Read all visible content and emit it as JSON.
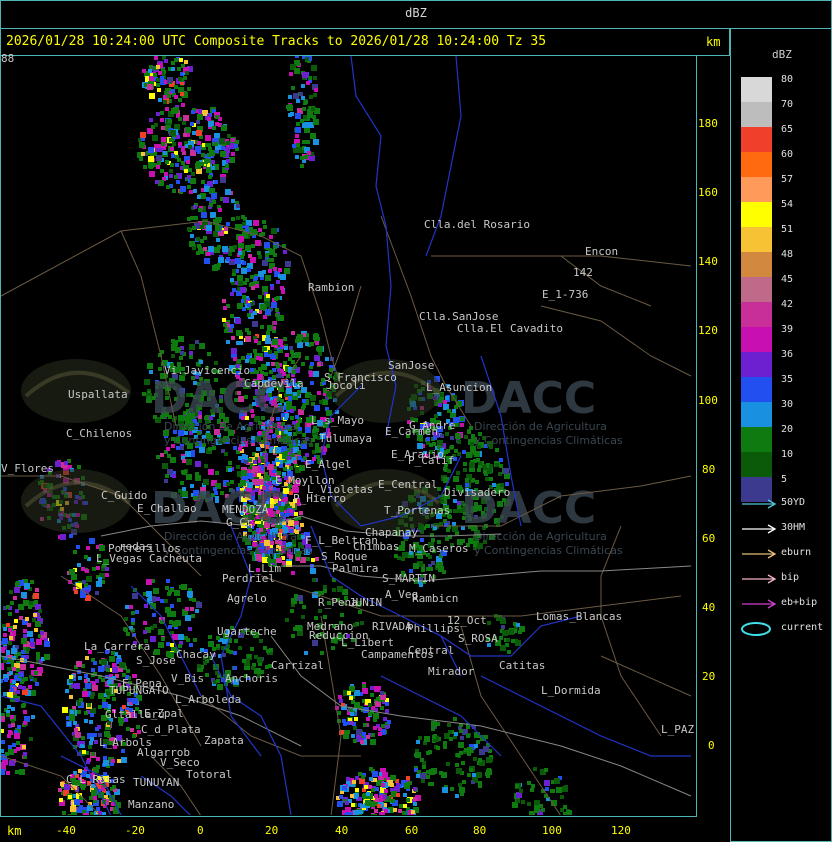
{
  "app": {
    "title": "dBZ"
  },
  "header": {
    "text": "2026/01/28 10:24:00 UTC Composite Tracks to 2026/01/28 10:24:00 Tz 35",
    "units": "km"
  },
  "axes": {
    "x_label": "km",
    "x_ticks": [
      "-40",
      "-20",
      "0",
      "20",
      "40",
      "60",
      "80",
      "100",
      "120"
    ],
    "y_ticks": [
      "180",
      "160",
      "140",
      "120",
      "100",
      "80",
      "60",
      "40",
      "20",
      "0"
    ]
  },
  "legend": {
    "title": "dBZ",
    "items": [
      {
        "label": "80",
        "color": "#d8d8d8"
      },
      {
        "label": "70",
        "color": "#bdbdbd"
      },
      {
        "label": "65",
        "color": "#f0402a"
      },
      {
        "label": "60",
        "color": "#ff6a10"
      },
      {
        "label": "57",
        "color": "#ff9a5a"
      },
      {
        "label": "54",
        "color": "#ffff00"
      },
      {
        "label": "51",
        "color": "#f7c234"
      },
      {
        "label": "48",
        "color": "#d2893f"
      },
      {
        "label": "45",
        "color": "#c06a8a"
      },
      {
        "label": "42",
        "color": "#c82f98"
      },
      {
        "label": "39",
        "color": "#c80fb0"
      },
      {
        "label": "36",
        "color": "#6d20d0"
      },
      {
        "label": "35",
        "color": "#2250f0"
      },
      {
        "label": "30",
        "color": "#1a90e0"
      },
      {
        "label": "20",
        "color": "#0e7a10"
      },
      {
        "label": "10",
        "color": "#0a5a0a"
      },
      {
        "label": "5",
        "color": "#3b3a8e"
      }
    ]
  },
  "tracks": [
    {
      "label": "50YD",
      "color": "#4fc8e0"
    },
    {
      "label": "30HM",
      "color": "#ffffff"
    },
    {
      "label": "eburn",
      "color": "#e8c07a"
    },
    {
      "label": "bip",
      "color": "#f4b4c4"
    },
    {
      "label": "eb+bip",
      "color": "#d040d0"
    },
    {
      "label": "current",
      "color": "#40e0e8"
    }
  ],
  "places": [
    {
      "name": "Clla.del Rosario"
    },
    {
      "name": "Encon"
    },
    {
      "name": "142"
    },
    {
      "name": "E_1-736"
    },
    {
      "name": "Rambion"
    },
    {
      "name": "Clla.SanJose"
    },
    {
      "name": "Clla.El Cavadito"
    },
    {
      "name": "Vi.Javicencio"
    },
    {
      "name": "S_Francisco"
    },
    {
      "name": "SanJose"
    },
    {
      "name": "L_Asuncion"
    },
    {
      "name": "Uspallata"
    },
    {
      "name": "C_Chilenos"
    },
    {
      "name": "Capdevila"
    },
    {
      "name": "Jocoli"
    },
    {
      "name": "L_s_Mayo"
    },
    {
      "name": "Tulumaya"
    },
    {
      "name": "E_Carmen"
    },
    {
      "name": "G_Andre"
    },
    {
      "name": "E_Arauio"
    },
    {
      "name": "P_Calif"
    },
    {
      "name": "E_Algel"
    },
    {
      "name": "E_Moyllon"
    },
    {
      "name": "L_Violetas"
    },
    {
      "name": "E_Central"
    },
    {
      "name": "Divisadero"
    },
    {
      "name": "C_Guido"
    },
    {
      "name": "P_Hierro"
    },
    {
      "name": "E_Challao"
    },
    {
      "name": "MENDOZA"
    },
    {
      "name": "G_Cr"
    },
    {
      "name": "T_Portenas"
    },
    {
      "name": "F_L_Beltran"
    },
    {
      "name": "Chapanay"
    },
    {
      "name": "Chimbas"
    },
    {
      "name": "M_Caseros"
    },
    {
      "name": "Potrerillos"
    },
    {
      "name": "L_Vegas"
    },
    {
      "name": "Cacheuta"
    },
    {
      "name": "S_Roque"
    },
    {
      "name": "Palmira"
    },
    {
      "name": "L_Lim"
    },
    {
      "name": "Perdriel"
    },
    {
      "name": "S_MARTIN"
    },
    {
      "name": "A_Veg"
    },
    {
      "name": "Rambicn"
    },
    {
      "name": "Agrelo"
    },
    {
      "name": "R_Pena"
    },
    {
      "name": "JUNIN"
    },
    {
      "name": "12_Oct"
    },
    {
      "name": "Lomas_Blancas"
    },
    {
      "name": "Ugarteche"
    },
    {
      "name": "Medrano"
    },
    {
      "name": "Reduccion"
    },
    {
      "name": "RIVADA"
    },
    {
      "name": "Phillips"
    },
    {
      "name": "S_ROSA"
    },
    {
      "name": "L_Libert"
    },
    {
      "name": "Campamentos"
    },
    {
      "name": "Central"
    },
    {
      "name": "La_Carrera"
    },
    {
      "name": "S_Jose"
    },
    {
      "name": "Chacay"
    },
    {
      "name": "Carrizal"
    },
    {
      "name": "Catitas"
    },
    {
      "name": "E_Pena"
    },
    {
      "name": "TUPUNGATO"
    },
    {
      "name": "V_Bis"
    },
    {
      "name": "Anchoris"
    },
    {
      "name": "Mirador"
    },
    {
      "name": "L_Dormida"
    },
    {
      "name": "L_Arboleda"
    },
    {
      "name": "Gltallaru"
    },
    {
      "name": "E_Zpal"
    },
    {
      "name": "L_PAZ"
    },
    {
      "name": "C_d_Plata"
    },
    {
      "name": "L_Arbols"
    },
    {
      "name": "Zapata"
    },
    {
      "name": "Algarrob"
    },
    {
      "name": "V_Seco"
    },
    {
      "name": "Totoral"
    },
    {
      "name": "TUNUYAN"
    },
    {
      "name": "C_L_Rosas"
    },
    {
      "name": "Manzano"
    },
    {
      "name": "V_Flores"
    },
    {
      "name": "redas"
    },
    {
      "name": "88"
    }
  ],
  "watermark": {
    "brand": "DACC",
    "line1": "Dirección de Agricultura",
    "line2": "y Contingencias Climáticas"
  }
}
